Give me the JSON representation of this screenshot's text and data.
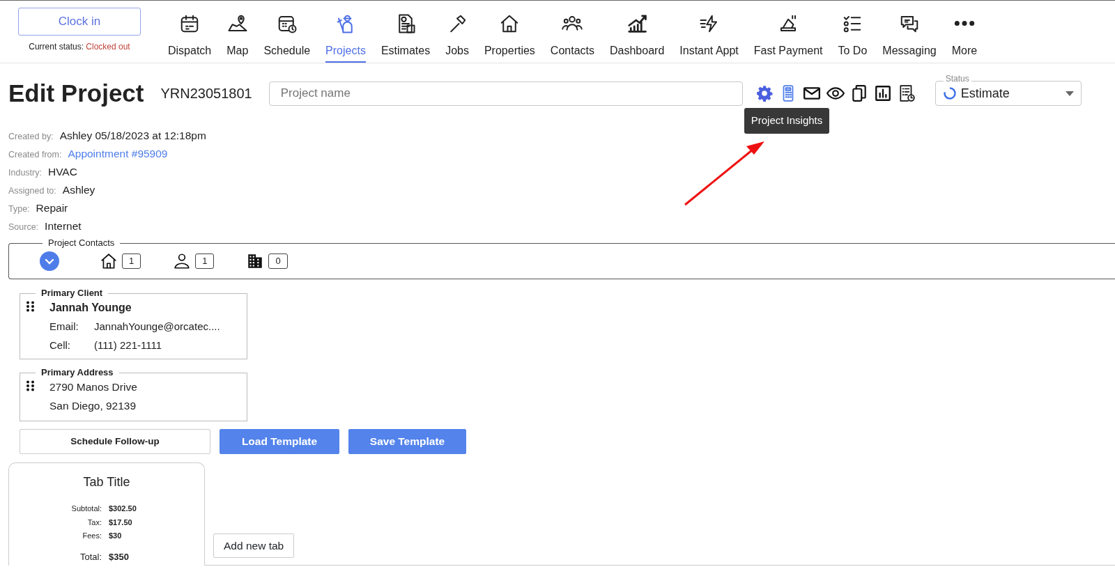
{
  "clock": {
    "button": "Clock in",
    "status_label": "Current status:",
    "status_value": "Clocked out"
  },
  "nav": [
    {
      "label": "Dispatch",
      "selected": false
    },
    {
      "label": "Map",
      "selected": false
    },
    {
      "label": "Schedule",
      "selected": false
    },
    {
      "label": "Projects",
      "selected": true
    },
    {
      "label": "Estimates",
      "selected": false
    },
    {
      "label": "Jobs",
      "selected": false
    },
    {
      "label": "Properties",
      "selected": false
    },
    {
      "label": "Contacts",
      "selected": false
    },
    {
      "label": "Dashboard",
      "selected": false
    },
    {
      "label": "Instant Appt",
      "selected": false
    },
    {
      "label": "Fast Payment",
      "selected": false
    },
    {
      "label": "To Do",
      "selected": false
    },
    {
      "label": "Messaging",
      "selected": false
    },
    {
      "label": "More",
      "selected": false
    }
  ],
  "title": "Edit Project",
  "project_number": "YRN23051801",
  "project_name": {
    "placeholder": "Project name"
  },
  "tools": [
    {
      "kind": "settings",
      "hovered": false
    },
    {
      "kind": "calculator",
      "hovered": true
    },
    {
      "kind": "email",
      "hovered": false
    },
    {
      "kind": "view",
      "hovered": false
    },
    {
      "kind": "copy",
      "hovered": false
    },
    {
      "kind": "chart",
      "hovered": false
    },
    {
      "kind": "history",
      "hovered": false
    }
  ],
  "tooltip": "Project Insights",
  "status": {
    "label": "Status",
    "value": "Estimate"
  },
  "details": [
    {
      "label": "Created by:",
      "value": "Ashley 05/18/2023 at 12:18pm",
      "kind": "text"
    },
    {
      "label": "Created from:",
      "value": "Appointment #95909",
      "kind": "link"
    },
    {
      "label": "Industry:",
      "value": "HVAC",
      "kind": "text"
    },
    {
      "label": "Assigned to:",
      "value": "Ashley",
      "kind": "text"
    },
    {
      "label": "Type:",
      "value": "Repair",
      "kind": "text"
    },
    {
      "label": "Source:",
      "value": "Internet",
      "kind": "text"
    }
  ],
  "contacts": {
    "legend": "Project Contacts",
    "counts": [
      {
        "kind": "property",
        "count": "1"
      },
      {
        "kind": "person",
        "count": "1"
      },
      {
        "kind": "organization",
        "count": "0"
      }
    ]
  },
  "primary_client": {
    "legend": "Primary Client",
    "name": "Jannah Younge",
    "fields": [
      {
        "label": "Email:",
        "value": "JannahYounge@orcatec...."
      },
      {
        "label": "Cell:",
        "value": "(111) 221-1111"
      }
    ]
  },
  "primary_address": {
    "legend": "Primary Address",
    "lines": [
      "2790 Manos Drive",
      "San Diego, 92139"
    ]
  },
  "buttons": [
    {
      "label": "Schedule Follow-up",
      "kind": "outline"
    },
    {
      "label": "Load Template",
      "kind": "primary"
    },
    {
      "label": "Save Template",
      "kind": "primary"
    }
  ],
  "tab": {
    "title": "Tab Title",
    "lines": [
      {
        "label": "Subtotal:",
        "value": "$302.50"
      },
      {
        "label": "Tax:",
        "value": "$17.50"
      },
      {
        "label": "Fees:",
        "value": "$30"
      }
    ],
    "total": {
      "label": "Total:",
      "value": "$350"
    }
  },
  "add_tab": "Add new tab"
}
